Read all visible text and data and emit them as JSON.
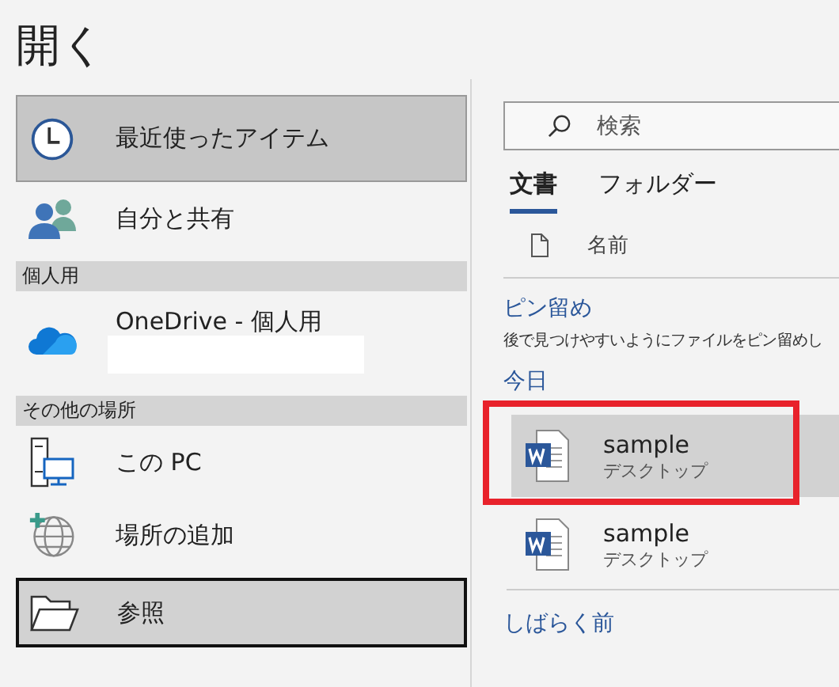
{
  "title": "開く",
  "nav": [
    {
      "kind": "item",
      "label": "最近使ったアイテム",
      "selected": true,
      "focused": false
    },
    {
      "kind": "item",
      "label": "自分と共有",
      "selected": false,
      "focused": false
    },
    {
      "kind": "header",
      "label": "個人用"
    },
    {
      "kind": "item",
      "label": "OneDrive - 個人用",
      "selected": false,
      "focused": false,
      "redacted": true
    },
    {
      "kind": "header",
      "label": "その他の場所"
    },
    {
      "kind": "item",
      "label": "この PC",
      "selected": false,
      "focused": false
    },
    {
      "kind": "item",
      "label": "場所の追加",
      "selected": false,
      "focused": false
    },
    {
      "kind": "item",
      "label": "参照",
      "selected": true,
      "focused": true
    }
  ],
  "search": {
    "placeholder": "検索"
  },
  "tabs": [
    {
      "label": "文書",
      "selected": true
    },
    {
      "label": "フォルダー",
      "selected": false
    }
  ],
  "column_header": "名前",
  "pinned": {
    "title": "ピン留め",
    "description": "後で見つけやすいようにファイルをピン留めし"
  },
  "groups": [
    {
      "title": "今日",
      "files": [
        {
          "name": "sample",
          "location": "デスクトップ",
          "selected": true,
          "highlighted": true
        },
        {
          "name": "sample",
          "location": "デスクトップ",
          "selected": false,
          "highlighted": false
        }
      ]
    },
    {
      "title": "しばらく前"
    }
  ]
}
